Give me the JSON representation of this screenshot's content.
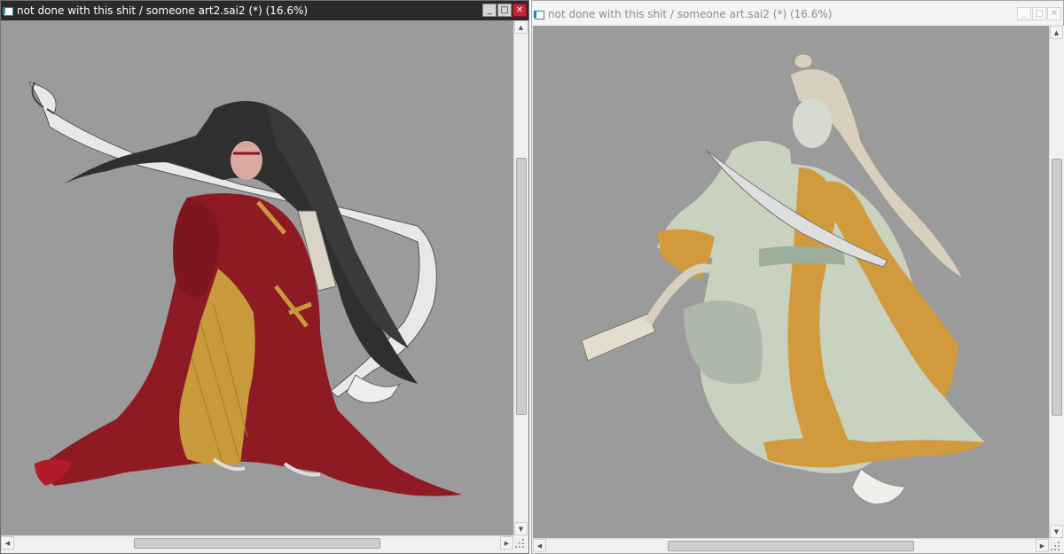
{
  "left_window": {
    "title": "not done with this shit / someone art2.sai2 (*) (16.6%)",
    "active": true,
    "controls": {
      "minimize": "_",
      "maximize": "□",
      "close": "✕"
    },
    "canvas_bg": "#9b9b9b",
    "icon": "sai-document-icon"
  },
  "right_window": {
    "title": "not done with this shit / someone art.sai2 (*) (16.6%)",
    "active": false,
    "controls": {
      "minimize": "_",
      "maximize": "□",
      "close": "✕"
    },
    "canvas_bg": "#9b9b9b",
    "icon": "sai-document-icon"
  },
  "scroll_arrows": {
    "up": "▲",
    "down": "▼",
    "left": "◀",
    "right": "▶"
  },
  "colors": {
    "active_titlebar": "#2b2b2b",
    "inactive_titlebar": "#f4f4f4",
    "close_button": "#c8243a",
    "robe_red": "#8e1a24",
    "robe_gold": "#c99a3c",
    "robe_pale_green": "#c9d1bf",
    "trim_orange": "#d19a3c"
  }
}
